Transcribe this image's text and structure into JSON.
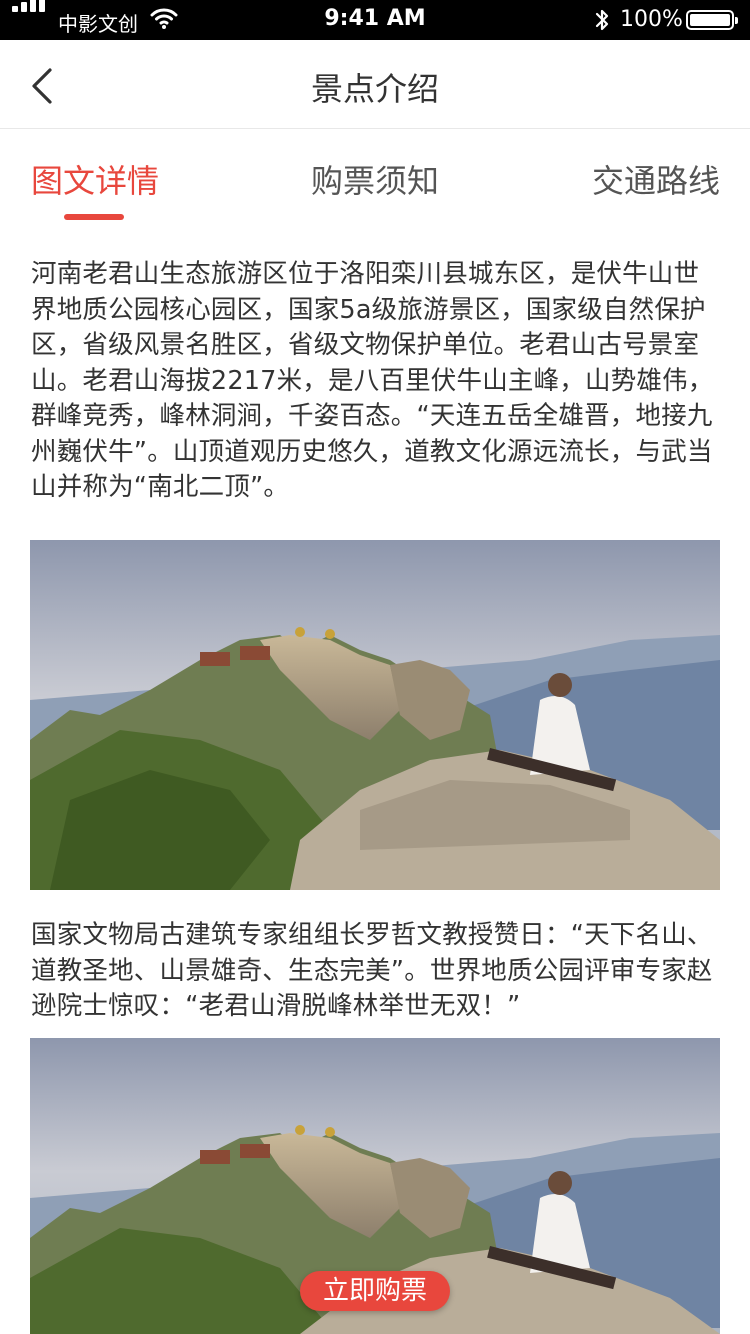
{
  "status_bar": {
    "carrier": "中影文创",
    "time": "9:41 AM",
    "battery": "100%",
    "icons": [
      "signal-icon",
      "wifi-icon",
      "bluetooth-icon",
      "battery-icon"
    ]
  },
  "nav": {
    "title": "景点介绍",
    "back_icon": "back-arrow-icon"
  },
  "tabs": [
    {
      "label": "图文详情",
      "active": true
    },
    {
      "label": "购票须知",
      "active": false
    },
    {
      "label": "交通路线",
      "active": false
    }
  ],
  "content": {
    "paragraph1": "河南老君山生态旅游区位于洛阳栾川县城东区，是伏牛山世界地质公园核心园区，国家5a级旅游景区，国家级自然保护区，省级风景名胜区，省级文物保护单位。老君山古号景室山。老君山海拔2217米，是八百里伏牛山主峰，山势雄伟，群峰竞秀，峰林洞涧，千姿百态。“天连五岳全雄晋，地接九州巍伏牛”。山顶道观历史悠久，道教文化源远流长，与武当山并称为“南北二顶”。",
    "paragraph2": "国家文物局古建筑专家组组长罗哲文教授赞日：“天下名山、道教圣地、山景雄奇、生态完美”。世界地质公园评审专家赵逊院士惊叹：“老君山滑脱峰林举世无双！”"
  },
  "buy_button": {
    "label": "立即购票"
  },
  "colors": {
    "accent": "#e8473d",
    "text": "#333333",
    "status_bar_bg": "#000000"
  }
}
